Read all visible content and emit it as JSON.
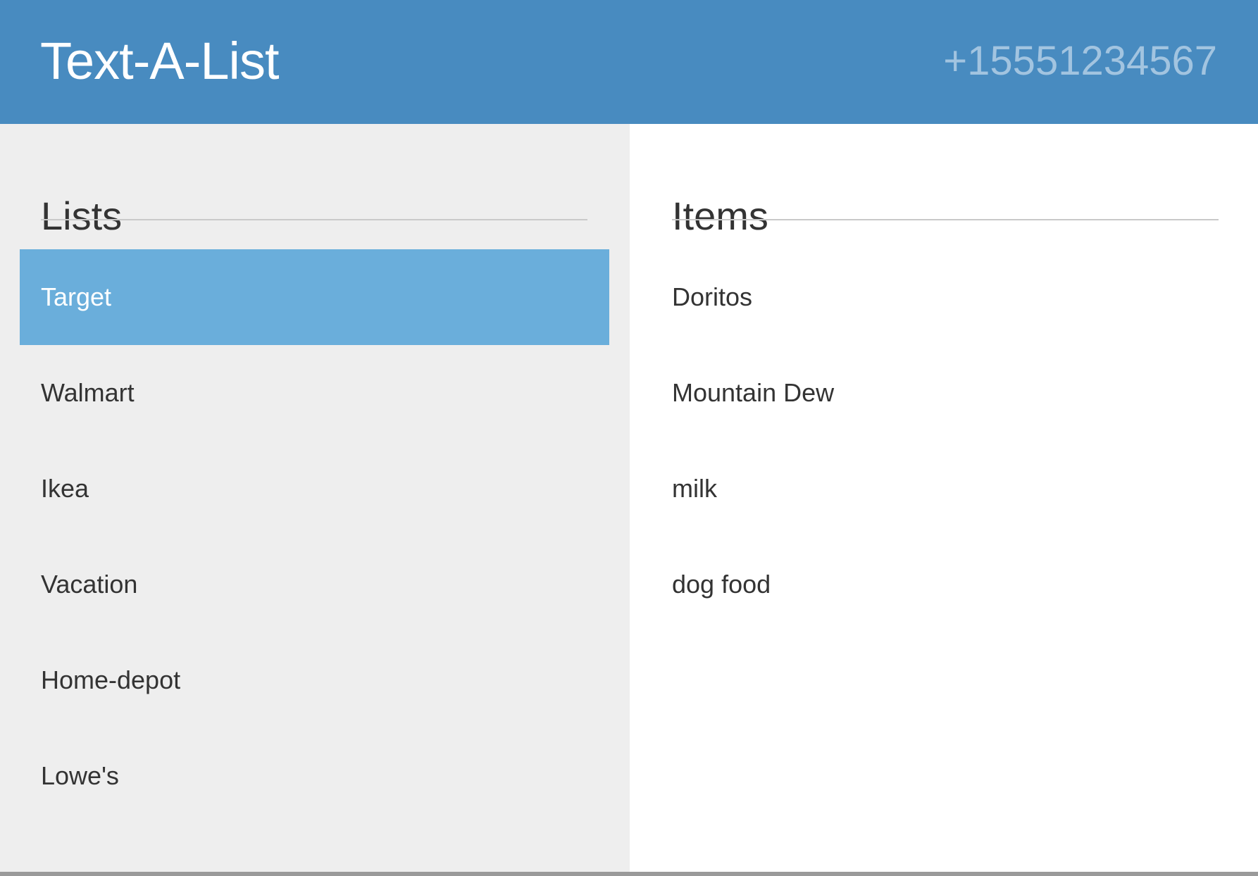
{
  "header": {
    "title": "Text-A-List",
    "phone": "+15551234567",
    "background_color": "#488bc0",
    "phone_color": "#a2c4e0"
  },
  "lists": {
    "heading": "Lists",
    "background_color": "#eeeeee",
    "selected_color": "#6aaedb",
    "selected_index": 0,
    "items": [
      {
        "label": "Target"
      },
      {
        "label": "Walmart"
      },
      {
        "label": "Ikea"
      },
      {
        "label": "Vacation"
      },
      {
        "label": "Home-depot"
      },
      {
        "label": "Lowe's"
      }
    ]
  },
  "items": {
    "heading": "Items",
    "rows": [
      {
        "label": "Doritos"
      },
      {
        "label": "Mountain Dew"
      },
      {
        "label": "milk"
      },
      {
        "label": "dog food"
      }
    ]
  }
}
